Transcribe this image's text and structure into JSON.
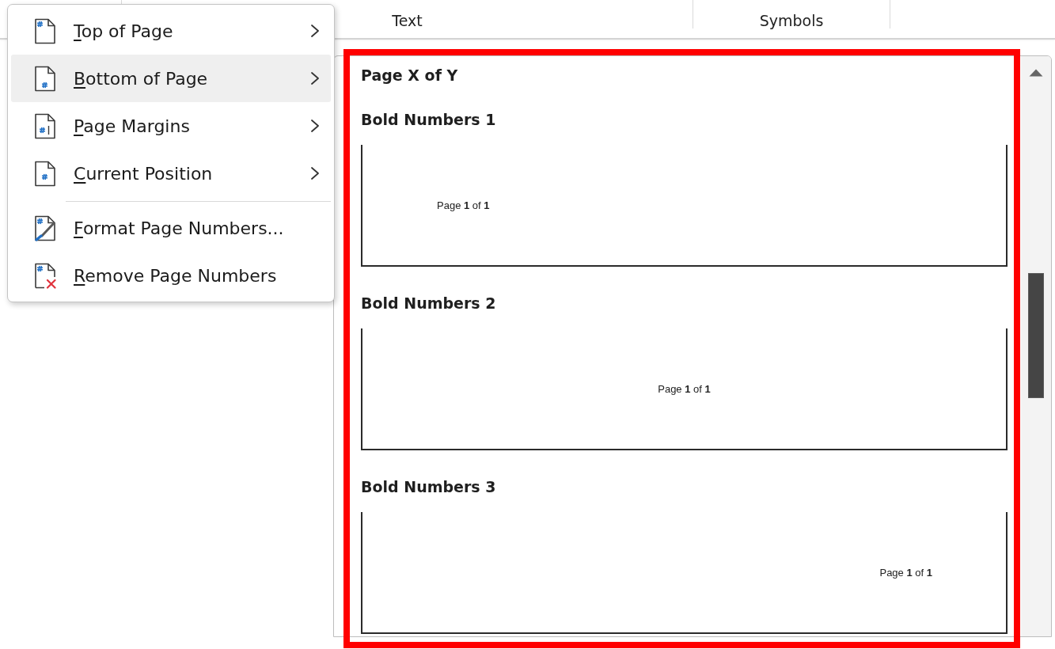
{
  "ribbon": {
    "groups": [
      {
        "label": "Text"
      },
      {
        "label": "Symbols"
      }
    ]
  },
  "menu": {
    "groups": [
      [
        {
          "label": "Top of Page",
          "access_key_shown": true,
          "has_submenu": true,
          "selected": false
        },
        {
          "label": "Bottom of Page",
          "access_key_shown": true,
          "has_submenu": true,
          "selected": true
        },
        {
          "label": "Page Margins",
          "access_key_shown": true,
          "has_submenu": true,
          "selected": false
        },
        {
          "label": "Current Position",
          "access_key_shown": true,
          "has_submenu": true,
          "selected": false
        }
      ],
      [
        {
          "label": "Format Page Numbers...",
          "access_key_shown": true,
          "has_submenu": false,
          "selected": false
        },
        {
          "label": "Remove Page Numbers",
          "access_key_shown": true,
          "has_submenu": false,
          "selected": false
        }
      ]
    ]
  },
  "gallery": {
    "highlighted": true,
    "category": "Page X of Y",
    "items": [
      {
        "title": "Bold Numbers 1",
        "preview": "Page **1** of **1**",
        "kind": "left"
      },
      {
        "title": "Bold Numbers 2",
        "preview": "Page **1** of **1**",
        "kind": "center"
      },
      {
        "title": "Bold Numbers 3",
        "preview": "Page **1** of **1**",
        "kind": "right"
      }
    ]
  }
}
